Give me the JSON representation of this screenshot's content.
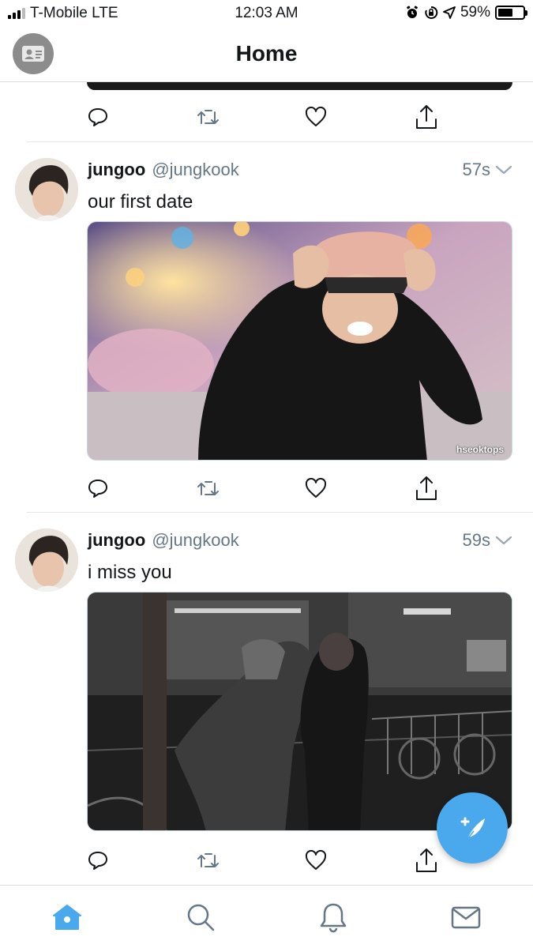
{
  "status_bar": {
    "carrier": "T-Mobile LTE",
    "time": "12:03 AM",
    "battery": "59%",
    "battery_level": 0.59
  },
  "header": {
    "title": "Home"
  },
  "tweets": [
    {
      "name": "jungoo",
      "handle": "@jungkook",
      "time": "57s",
      "text": "our first date",
      "media_watermark": "hseoktops"
    },
    {
      "name": "jungoo",
      "handle": "@jungkook",
      "time": "59s",
      "text": "i miss you"
    }
  ],
  "colors": {
    "accent": "#4aa8ec",
    "secondary_text": "#657786",
    "icon_gray": "#657786"
  }
}
